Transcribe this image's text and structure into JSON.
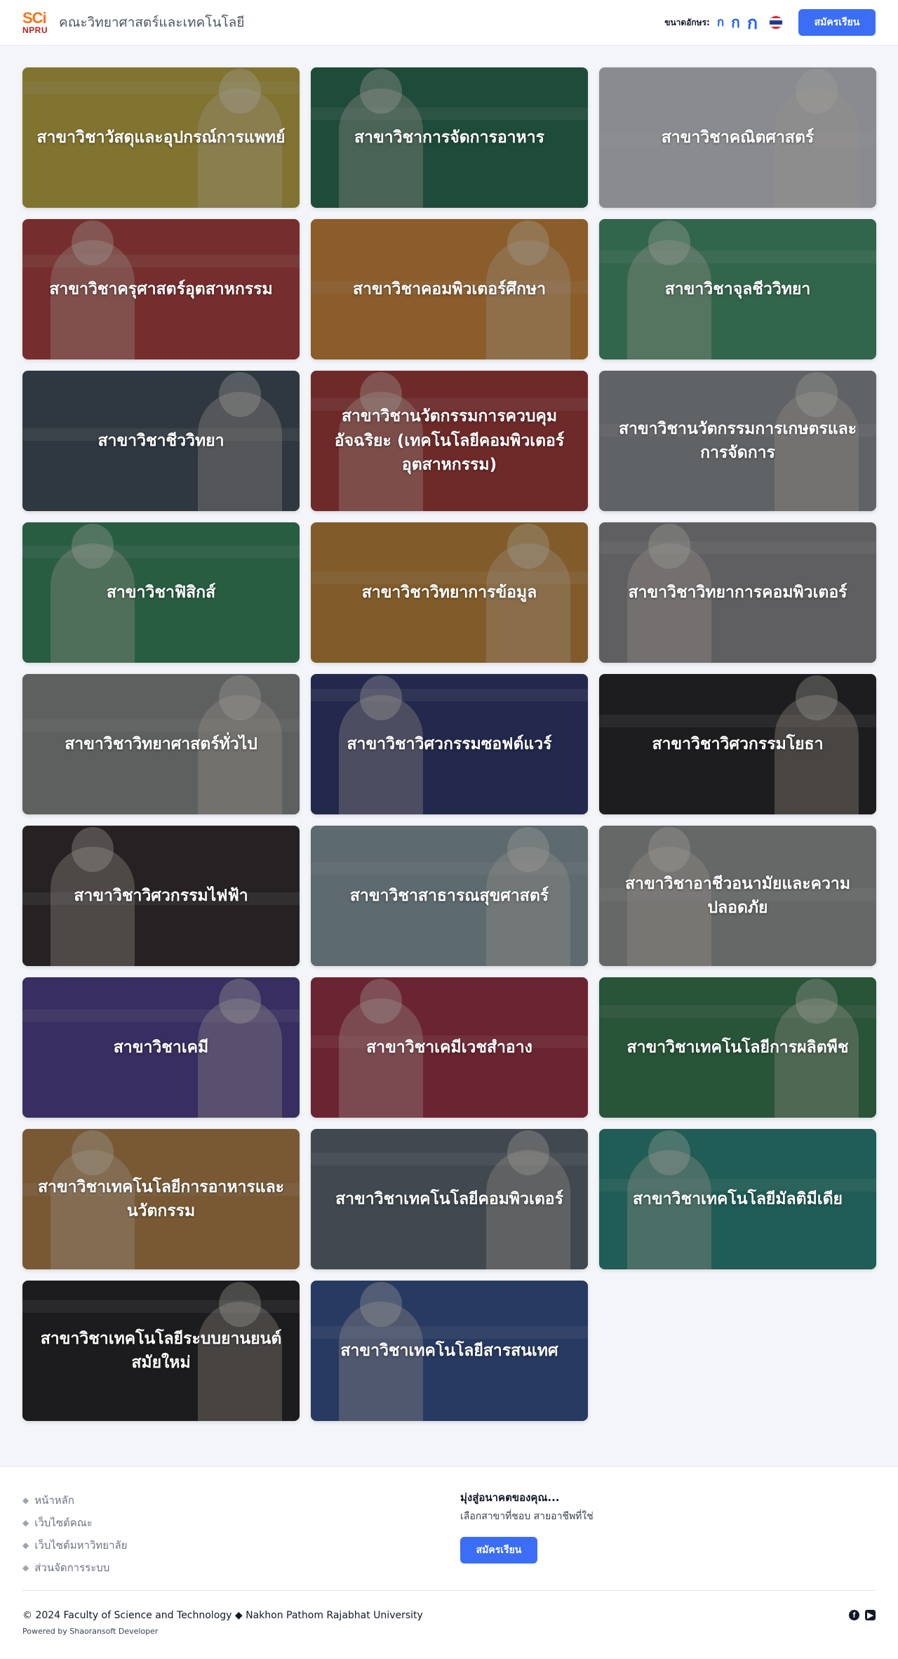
{
  "header": {
    "logo_top": "SCi",
    "logo_bottom": "NPRU",
    "brand": "คณะวิทยาศาสตร์และเทคโนโลยี",
    "font_size_label": "ขนาดอักษร:",
    "font_small": "ก",
    "font_medium": "ก",
    "font_large": "ก",
    "apply_button": "สมัครเรียน"
  },
  "programs": [
    {
      "title": "สาขาวิชาวัสดุและอุปกรณ์การแพทย์",
      "bg": "#c9b23a"
    },
    {
      "title": "สาขาวิชาการจัดการอาหาร",
      "bg": "#1f6b4a"
    },
    {
      "title": "สาขาวิชาคณิตศาสตร์",
      "bg": "#d6d9de"
    },
    {
      "title": "สาขาวิชาครุศาสตร์อุตสาหกรรม",
      "bg": "#b43a34"
    },
    {
      "title": "สาขาวิชาคอมพิวเตอร์ศึกษา",
      "bg": "#d98a2f"
    },
    {
      "title": "สาขาวิชาจุลชีววิทยา",
      "bg": "#3f9a6a"
    },
    {
      "title": "สาขาวิชาชีววิทยา",
      "bg": "#3b4a55"
    },
    {
      "title": "สาขาวิชานวัตกรรมการควบคุมอัจฉริยะ (เทคโนโลยีคอมพิวเตอร์อุตสาหกรรม)",
      "bg": "#a8322e"
    },
    {
      "title": "สาขาวิชานวัตกรรมการเกษตรและการจัดการ",
      "bg": "#8f9496"
    },
    {
      "title": "สาขาวิชาฟิสิกส์",
      "bg": "#2f8a58"
    },
    {
      "title": "สาขาวิชาวิทยาการข้อมูล",
      "bg": "#c9892f"
    },
    {
      "title": "สาขาวิชาวิทยาการคอมพิวเตอร์",
      "bg": "#8e8e8e"
    },
    {
      "title": "สาขาวิชาวิทยาศาสตร์ทั่วไป",
      "bg": "#8a8f8a"
    },
    {
      "title": "สาขาวิชาวิศวกรรมซอฟต์แวร์",
      "bg": "#27306a"
    },
    {
      "title": "สาขาวิชาวิศวกรรมโยธา",
      "bg": "#1c1c1c"
    },
    {
      "title": "สาขาวิชาวิศวกรรมไฟฟ้า",
      "bg": "#2b2523"
    },
    {
      "title": "สาขาวิชาสาธารณสุขศาสตร์",
      "bg": "#8aa0a8"
    },
    {
      "title": "สาขาวิชาอาชีวอนามัยและความปลอดภัย",
      "bg": "#9a9d9a"
    },
    {
      "title": "สาขาวิชาเคมี",
      "bg": "#4b3a8e"
    },
    {
      "title": "สาขาวิชาเคมีเวชสำอาง",
      "bg": "#a3283c"
    },
    {
      "title": "สาขาวิชาเทคโนโลยีการผลิตพืช",
      "bg": "#2f7a46"
    },
    {
      "title": "สาขาวิชาเทคโนโลยีการอาหารและนวัตกรรม",
      "bg": "#b98340"
    },
    {
      "title": "สาขาวิชาเทคโนโลยีคอมพิวเตอร์",
      "bg": "#5a6670"
    },
    {
      "title": "สาขาวิชาเทคโนโลยีมัลติมีเดีย",
      "bg": "#1f8a7a"
    },
    {
      "title": "สาขาวิชาเทคโนโลยีระบบยานยนต์สมัยใหม่",
      "bg": "#1a1a1a"
    },
    {
      "title": "สาขาวิชาเทคโนโลยีสารสนเทศ",
      "bg": "#2e4f8e"
    }
  ],
  "footer": {
    "links": [
      "หน้าหลัก",
      "เว็บไซต์คณะ",
      "เว็บไซต์มหาวิทยาลัย",
      "ส่วนจัดการระบบ"
    ],
    "cta_title": "มุ่งสู่อนาคตของคุณ...",
    "cta_subtitle": "เลือกสาขาที่ชอบ สายอาชีพที่ใช่",
    "cta_button": "สมัครเรียน",
    "copyright": "© 2024 Faculty of Science and Technology ◆ Nakhon Pathom Rajabhat University",
    "powered_by": "Powered by Shaoransoft Developer",
    "social_facebook": "f",
    "social_youtube": "▶"
  },
  "colors": {
    "accent": "#3b6ef5",
    "brand_orange": "#f97316",
    "brand_red": "#b91c1c"
  }
}
